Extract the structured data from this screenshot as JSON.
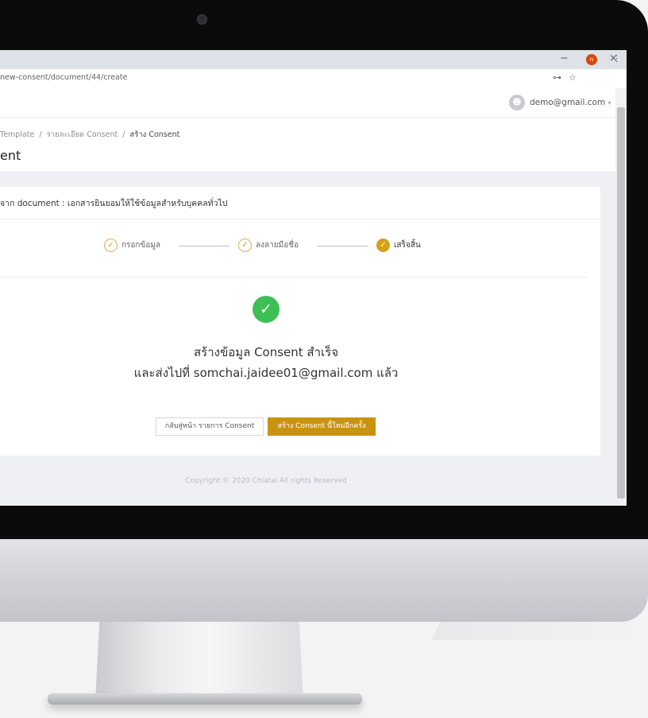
{
  "browser": {
    "url": "new-consent/document/44/create",
    "window_controls": {
      "minimize": "−",
      "maximize": "□",
      "close": "×"
    },
    "toolbar_icons": {
      "key": "⊶",
      "star": "☆",
      "profile_initial": "n",
      "menu": "⋮"
    }
  },
  "appbar": {
    "user_email": "demo@gmail.com",
    "user_caret": "▾"
  },
  "header": {
    "breadcrumb": [
      "Template",
      "รายละเอียด Consent",
      "สร้าง Consent"
    ],
    "separator": "/",
    "title": "ent"
  },
  "card": {
    "title": "จาก document : เอกสารยินยอมให้ใช้ข้อมูลสำหรับบุคคลทั่วไป",
    "steps": [
      {
        "label": "กรอกข้อมูล",
        "status": "complete"
      },
      {
        "label": "ลงลายมือชื่อ",
        "status": "complete"
      },
      {
        "label": "เสร็จสิ้น",
        "status": "current"
      }
    ],
    "check_glyph": "✓",
    "success_line1": "สร้างข้อมูล Consent สำเร็จ",
    "success_line2": "และส่งไปที่ somchai.jaidee01@gmail.com แล้ว",
    "back_button": "กลับสู่หน้า รายการ Consent",
    "new_button": "สร้าง Consent นี้ใหม่อีกครั้ง"
  },
  "footer": "Copyright © 2020 Chiatai All rights Reserved",
  "colors": {
    "accent": "#c99312",
    "success": "#3dbf55",
    "page_bg": "#eef0f4"
  }
}
